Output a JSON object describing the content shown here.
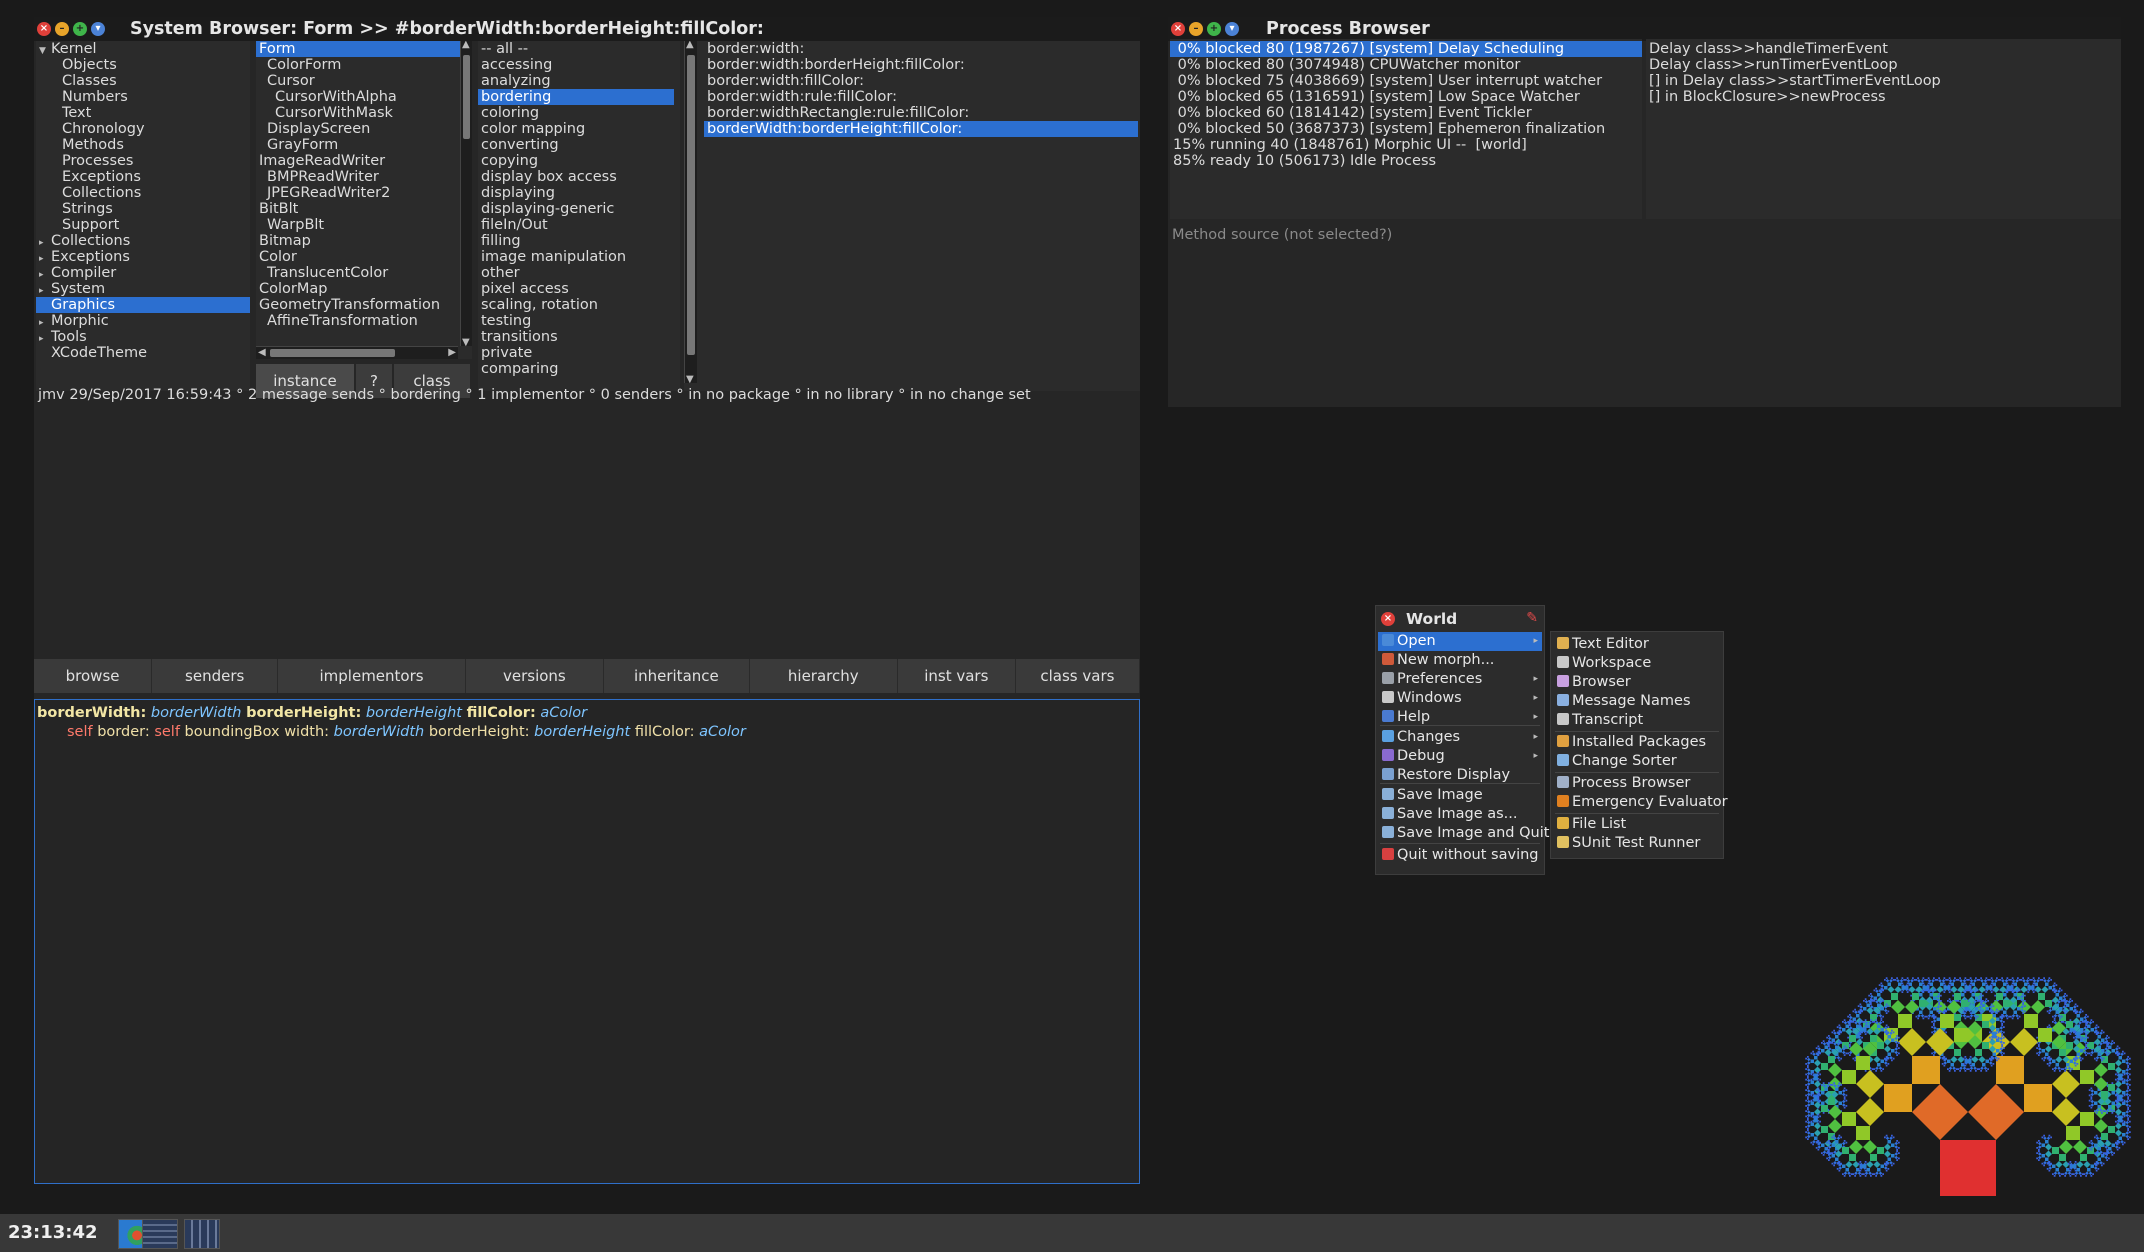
{
  "browser": {
    "title": "System Browser: Form >> #borderWidth:borderHeight:fillColor:",
    "categories": [
      {
        "label": "Kernel",
        "arrow": "▼",
        "child": false
      },
      {
        "label": "Objects",
        "child": true
      },
      {
        "label": "Classes",
        "child": true
      },
      {
        "label": "Numbers",
        "child": true
      },
      {
        "label": "Text",
        "child": true
      },
      {
        "label": "Chronology",
        "child": true
      },
      {
        "label": "Methods",
        "child": true
      },
      {
        "label": "Processes",
        "child": true
      },
      {
        "label": "Exceptions",
        "child": true
      },
      {
        "label": "Collections",
        "child": true
      },
      {
        "label": "Strings",
        "child": true
      },
      {
        "label": "Support",
        "child": true
      },
      {
        "label": "Collections",
        "arrow": "▸",
        "child": false
      },
      {
        "label": "Exceptions",
        "arrow": "▸",
        "child": false
      },
      {
        "label": "Compiler",
        "arrow": "▸",
        "child": false
      },
      {
        "label": "System",
        "arrow": "▸",
        "child": false
      },
      {
        "label": "Graphics",
        "child": false,
        "selected": true
      },
      {
        "label": "Morphic",
        "arrow": "▸",
        "child": false
      },
      {
        "label": "Tools",
        "arrow": "▸",
        "child": false
      },
      {
        "label": "XCodeTheme",
        "child": false
      }
    ],
    "classes": [
      {
        "label": "Form",
        "indent": 0,
        "selected": true
      },
      {
        "label": "ColorForm",
        "indent": 1
      },
      {
        "label": "Cursor",
        "indent": 1
      },
      {
        "label": "CursorWithAlpha",
        "indent": 2
      },
      {
        "label": "CursorWithMask",
        "indent": 2
      },
      {
        "label": "DisplayScreen",
        "indent": 1
      },
      {
        "label": "GrayForm",
        "indent": 1
      },
      {
        "label": "ImageReadWriter",
        "indent": 0
      },
      {
        "label": "BMPReadWriter",
        "indent": 1
      },
      {
        "label": "JPEGReadWriter2",
        "indent": 1
      },
      {
        "label": "BitBlt",
        "indent": 0
      },
      {
        "label": "WarpBlt",
        "indent": 1
      },
      {
        "label": "Bitmap",
        "indent": 0
      },
      {
        "label": "Color",
        "indent": 0
      },
      {
        "label": "TranslucentColor",
        "indent": 1
      },
      {
        "label": "ColorMap",
        "indent": 0
      },
      {
        "label": "GeometryTransformation",
        "indent": 0
      },
      {
        "label": "AffineTransformation",
        "indent": 1
      }
    ],
    "class_toggle": {
      "instance": "instance",
      "help": "?",
      "class": "class"
    },
    "protocols": [
      {
        "label": "-- all --"
      },
      {
        "label": "accessing"
      },
      {
        "label": "analyzing"
      },
      {
        "label": "bordering",
        "selected": true
      },
      {
        "label": "coloring"
      },
      {
        "label": "color mapping"
      },
      {
        "label": "converting"
      },
      {
        "label": "copying"
      },
      {
        "label": "display box access"
      },
      {
        "label": "displaying"
      },
      {
        "label": "displaying-generic"
      },
      {
        "label": "fileIn/Out"
      },
      {
        "label": "filling"
      },
      {
        "label": "image manipulation"
      },
      {
        "label": "other"
      },
      {
        "label": "pixel access"
      },
      {
        "label": "scaling, rotation"
      },
      {
        "label": "testing"
      },
      {
        "label": "transitions"
      },
      {
        "label": "private"
      },
      {
        "label": "comparing"
      }
    ],
    "methods": [
      {
        "label": "border:width:"
      },
      {
        "label": "border:width:borderHeight:fillColor:"
      },
      {
        "label": "border:width:fillColor:"
      },
      {
        "label": "border:width:rule:fillColor:"
      },
      {
        "label": "border:widthRectangle:rule:fillColor:"
      },
      {
        "label": "borderWidth:borderHeight:fillColor:",
        "selected": true
      }
    ],
    "status": "jmv 29/Sep/2017 16:59:43 ° 2 message sends ° bordering ° 1 implementor ° 0 senders ° in no package ° in no library ° in no change set",
    "buttons": [
      "browse",
      "senders",
      "implementors",
      "versions",
      "inheritance",
      "hierarchy",
      "inst vars",
      "class vars"
    ],
    "code": {
      "l1_kw1": "borderWidth:",
      "l1_arg1": "borderWidth",
      "l1_kw2": "borderHeight:",
      "l1_arg2": "borderHeight",
      "l1_kw3": "fillColor:",
      "l1_arg3": "aColor",
      "l2_self1": "self",
      "l2_msg1": "border:",
      "l2_self2": "self",
      "l2_msg2": "boundingBox width:",
      "l2_arg1": "borderWidth",
      "l2_msg3": "borderHeight:",
      "l2_arg2": "borderHeight",
      "l2_msg4": "fillColor:",
      "l2_arg3": "aColor"
    }
  },
  "process_browser": {
    "title": "Process Browser",
    "processes": [
      {
        "label": " 0% blocked 80 (1987267) [system] Delay Scheduling",
        "selected": true
      },
      {
        "label": " 0% blocked 80 (3074948) CPUWatcher monitor"
      },
      {
        "label": " 0% blocked 75 (4038669) [system] User interrupt watcher"
      },
      {
        "label": " 0% blocked 65 (1316591) [system] Low Space Watcher"
      },
      {
        "label": " 0% blocked 60 (1814142) [system] Event Tickler"
      },
      {
        "label": " 0% blocked 50 (3687373) [system] Ephemeron finalization"
      },
      {
        "label": "15% running 40 (1848761) Morphic UI --  [world]"
      },
      {
        "label": "85% ready 10 (506173) Idle Process"
      }
    ],
    "stack": [
      {
        "label": "Delay class>>handleTimerEvent"
      },
      {
        "label": "Delay class>>runTimerEventLoop"
      },
      {
        "label": "[] in Delay class>>startTimerEventLoop"
      },
      {
        "label": "[] in BlockClosure>>newProcess"
      }
    ],
    "source_placeholder": "Method source (not selected?)"
  },
  "world_menu": {
    "title": "World",
    "items": [
      {
        "label": "Open",
        "icon_color": "#4a8ad8",
        "submenu": true,
        "selected": true
      },
      {
        "label": "New morph...",
        "icon_color": "#d05a3a"
      },
      {
        "label": "Preferences",
        "icon_color": "#9aa0a8",
        "submenu": true
      },
      {
        "label": "Windows",
        "icon_color": "#c9c9c9",
        "submenu": true
      },
      {
        "label": "Help",
        "icon_color": "#4a7ad0",
        "submenu": true
      },
      {
        "label": "Changes",
        "icon_color": "#5aa0e0",
        "submenu": true
      },
      {
        "label": "Debug",
        "icon_color": "#8a6ad0",
        "submenu": true
      },
      {
        "label": "Restore Display",
        "icon_color": "#7aa0d0"
      },
      {
        "label": "Save Image",
        "icon_color": "#8ab0d8"
      },
      {
        "label": "Save Image as...",
        "icon_color": "#8ab0d8"
      },
      {
        "label": "Save Image and Quit",
        "icon_color": "#8ab0d8"
      },
      {
        "label": "Quit without saving",
        "icon_color": "#d84040"
      }
    ]
  },
  "open_submenu": {
    "items": [
      {
        "label": "Text Editor",
        "icon_color": "#e0b050"
      },
      {
        "label": "Workspace",
        "icon_color": "#c8c8c8"
      },
      {
        "label": "Browser",
        "icon_color": "#c8a0e0"
      },
      {
        "label": "Message Names",
        "icon_color": "#8ab0e0"
      },
      {
        "label": "Transcript",
        "icon_color": "#c8c8c8"
      },
      {
        "label": "Installed Packages",
        "icon_color": "#e0a040"
      },
      {
        "label": "Change Sorter",
        "icon_color": "#80b0e0"
      },
      {
        "label": "Process Browser",
        "icon_color": "#a0b0c8"
      },
      {
        "label": "Emergency Evaluator",
        "icon_color": "#e08020"
      },
      {
        "label": "File List",
        "icon_color": "#e0b040"
      },
      {
        "label": "SUnit Test Runner",
        "icon_color": "#e0c060"
      }
    ]
  },
  "taskbar": {
    "clock": "23:13:42"
  },
  "colors": {
    "selection": "#2c6fd0",
    "background": "#1a1a1a",
    "pane": "#2b2b2b"
  }
}
